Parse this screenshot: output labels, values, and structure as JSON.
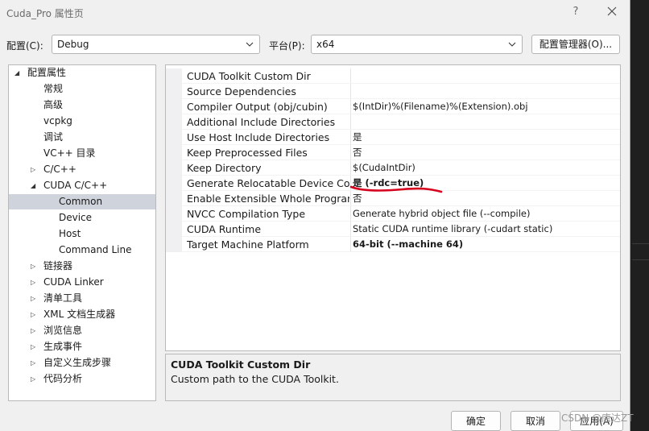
{
  "window": {
    "title": "Cuda_Pro 属性页",
    "help": "?",
    "close_icon": "close-icon"
  },
  "config": {
    "label": "配置(C):",
    "value": "Debug"
  },
  "platform": {
    "label": "平台(P):",
    "value": "x64"
  },
  "config_manager": {
    "label": "配置管理器(O)..."
  },
  "tree": {
    "items": [
      {
        "label": "配置属性",
        "arrow": "◢"
      },
      {
        "label": "常规",
        "arrow": ""
      },
      {
        "label": "高级",
        "arrow": ""
      },
      {
        "label": "vcpkg",
        "arrow": ""
      },
      {
        "label": "调试",
        "arrow": ""
      },
      {
        "label": "VC++ 目录",
        "arrow": ""
      },
      {
        "label": "C/C++",
        "arrow": "▷"
      },
      {
        "label": "CUDA C/C++",
        "arrow": "◢"
      },
      {
        "label": "Common",
        "arrow": ""
      },
      {
        "label": "Device",
        "arrow": ""
      },
      {
        "label": "Host",
        "arrow": ""
      },
      {
        "label": "Command Line",
        "arrow": ""
      },
      {
        "label": "链接器",
        "arrow": "▷"
      },
      {
        "label": "CUDA Linker",
        "arrow": "▷"
      },
      {
        "label": "清单工具",
        "arrow": "▷"
      },
      {
        "label": "XML 文档生成器",
        "arrow": "▷"
      },
      {
        "label": "浏览信息",
        "arrow": "▷"
      },
      {
        "label": "生成事件",
        "arrow": "▷"
      },
      {
        "label": "自定义生成步骤",
        "arrow": "▷"
      },
      {
        "label": "代码分析",
        "arrow": "▷"
      }
    ],
    "selected": "Common"
  },
  "properties": [
    {
      "name": "CUDA Toolkit Custom Dir",
      "value": ""
    },
    {
      "name": "Source Dependencies",
      "value": ""
    },
    {
      "name": "Compiler Output (obj/cubin)",
      "value": "$(IntDir)%(Filename)%(Extension).obj"
    },
    {
      "name": "Additional Include Directories",
      "value": ""
    },
    {
      "name": "Use Host Include Directories",
      "value": "是"
    },
    {
      "name": "Keep Preprocessed Files",
      "value": "否"
    },
    {
      "name": "Keep Directory",
      "value": "$(CudaIntDir)"
    },
    {
      "name": "Generate Relocatable Device Code",
      "value": "是 (-rdc=true)"
    },
    {
      "name": "Enable Extensible Whole Program",
      "value": "否"
    },
    {
      "name": "NVCC Compilation Type",
      "value": "Generate hybrid object file (--compile)"
    },
    {
      "name": "CUDA Runtime",
      "value": "Static CUDA runtime library (-cudart static)"
    },
    {
      "name": "Target Machine Platform",
      "value": "64-bit (--machine 64)"
    }
  ],
  "description": {
    "title": "CUDA Toolkit Custom Dir",
    "text": "Custom path to the CUDA Toolkit."
  },
  "buttons": {
    "ok": "确定",
    "cancel": "取消",
    "apply": "应用(A)"
  },
  "watermark": "CSDN @唐达ZT",
  "annotation_color": "#d6001c"
}
